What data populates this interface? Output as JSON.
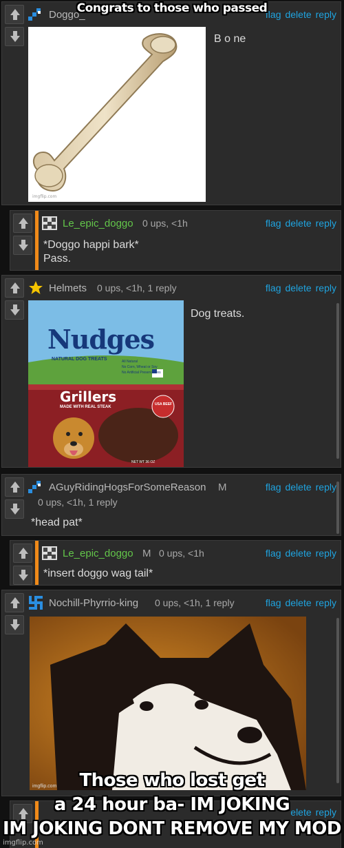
{
  "meme": {
    "top_caption": "Congrats to those who passed",
    "bottom_caption_line1": "Those who lost get",
    "bottom_caption_line2": "a 24 hour ba- IM JOKING",
    "bottom_caption_line3": "IM JOKING DONT REMOVE MY MOD",
    "watermark": "imgflip.com"
  },
  "actions": {
    "flag": "flag",
    "delete": "delete",
    "reply": "reply"
  },
  "comments": [
    {
      "username": "Doggo_",
      "body": "B o ne",
      "image": "bone"
    },
    {
      "username": "Le_epic_doggo",
      "meta": "0 ups, <1h",
      "body_line1": "*Doggo happi bark*",
      "body_line2": "Pass."
    },
    {
      "username": "Helmets",
      "meta": "0 ups, <1h, 1 reply",
      "body": "Dog treats.",
      "image": {
        "brand": "Nudges",
        "tagline": "NATURAL DOG TREATS",
        "product": "Grillers",
        "subtitle": "MADE WITH REAL STEAK",
        "bullets": [
          "All Natural",
          "No Corn, Wheat or Soy",
          "No Artificial Preservatives"
        ],
        "seal": "USA BEEF",
        "weight": "NET WT 36 OZ"
      }
    },
    {
      "username": "AGuyRidingHogsForSomeReason",
      "badge": "M",
      "meta": "0 ups, <1h, 1 reply",
      "body": "*head pat*"
    },
    {
      "username": "Le_epic_doggo",
      "badge": "M",
      "meta": "0 ups, <1h",
      "body": "*insert doggo wag tail*"
    },
    {
      "username": "Nochill-Phyrrio-king",
      "meta": "0 ups, <1h, 1 reply",
      "image": "husky",
      "image_watermark": "imgflip.com"
    },
    {
      "action_partial": "elete",
      "reply": "reply"
    }
  ],
  "colors": {
    "link": "#1fa4e0",
    "username_green": "#63c64a",
    "accent_orange": "#f08a19",
    "panel": "#2b2b2b"
  }
}
